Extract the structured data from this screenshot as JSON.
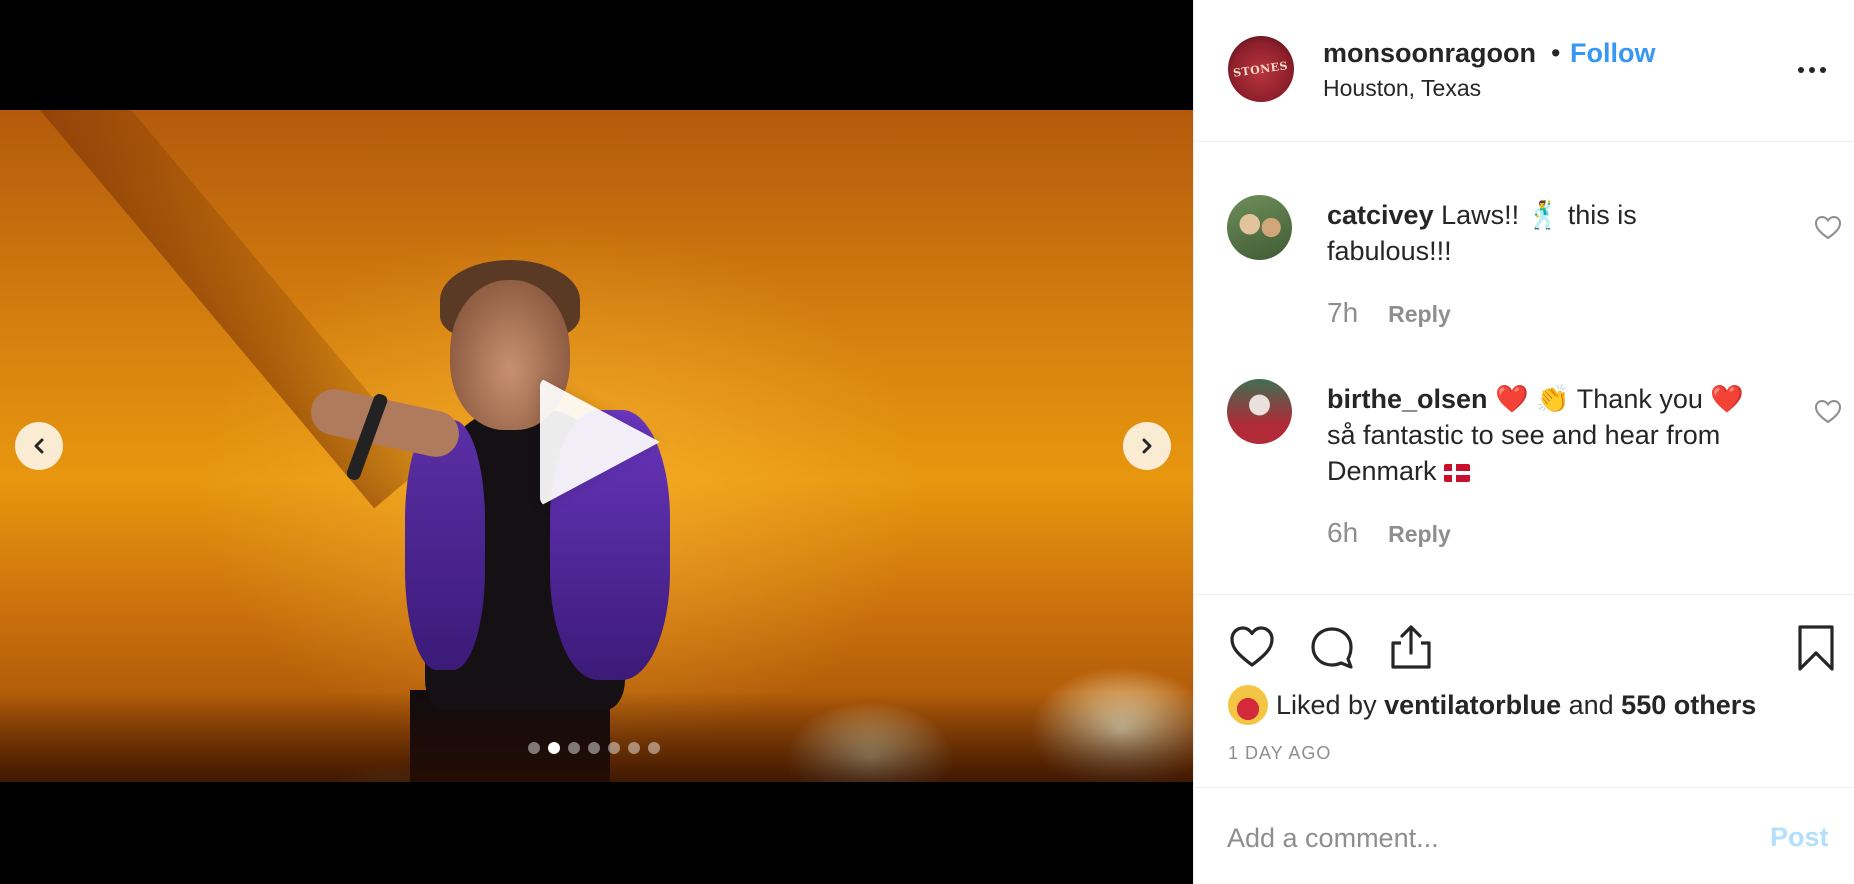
{
  "media": {
    "carousel_dots": 7,
    "active_dot_index": 1
  },
  "header": {
    "username": "monsoonragoon",
    "separator": "•",
    "follow_label": "Follow",
    "location": "Houston, Texas",
    "avatar_text": "STONES"
  },
  "comments": [
    {
      "user": "catcivey",
      "text": " Laws!! 🕺 this is fabulous!!!",
      "time": "7h",
      "reply_label": "Reply"
    },
    {
      "user": "birthe_olsen",
      "text_part1": " ❤️ 👏 Thank you ❤️ så fantastic to see and hear from Denmark",
      "time": "6h",
      "reply_label": "Reply"
    }
  ],
  "likes": {
    "prefix": "Liked by ",
    "user": "ventilatorblue",
    "middle": " and ",
    "others": "550 others"
  },
  "timestamp": "1 DAY AGO",
  "add_comment": {
    "placeholder": "Add a comment...",
    "post_label": "Post"
  },
  "colors": {
    "accent": "#3897f0",
    "text": "#262626",
    "muted": "#8e8e8e",
    "post_disabled": "#b2dffc"
  }
}
